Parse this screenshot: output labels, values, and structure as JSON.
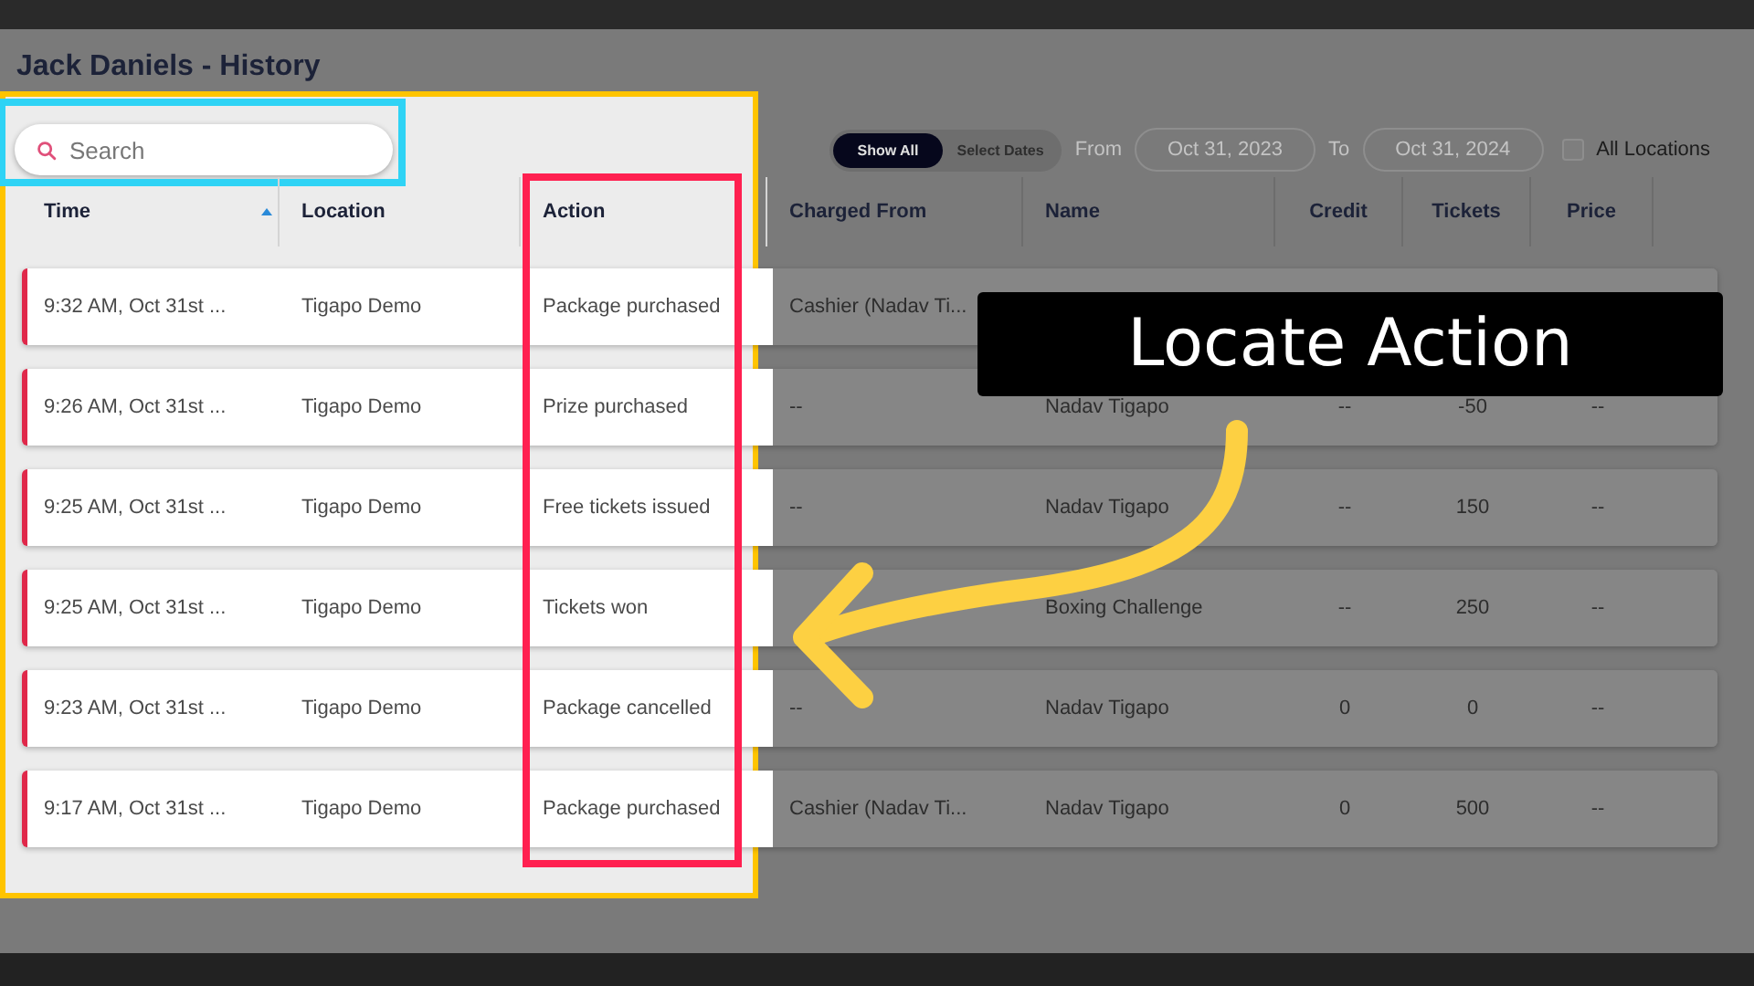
{
  "window": {
    "title": "Jack Daniels - History"
  },
  "search": {
    "placeholder": "Search",
    "outlined": true
  },
  "date_mode": [
    {
      "label": "Show All",
      "selected": true
    },
    {
      "label": "Select Dates",
      "selected": false
    }
  ],
  "date_range": {
    "from_label": "From",
    "from_value": "Oct 31, 2023",
    "to_label": "To",
    "to_value": "Oct 31, 2024"
  },
  "all_locations": {
    "label": "All Locations",
    "checked": false
  },
  "table": {
    "columns": [
      {
        "label": "Time",
        "sorted": true,
        "highlighted": true,
        "outlined": false
      },
      {
        "label": "Location",
        "sorted": false,
        "highlighted": true,
        "outlined": false
      },
      {
        "label": "Action",
        "sorted": false,
        "highlighted": true,
        "outlined": true
      },
      {
        "label": "Charged From",
        "sorted": false,
        "highlighted": false,
        "outlined": false
      },
      {
        "label": "Name",
        "sorted": false,
        "highlighted": false,
        "outlined": false
      },
      {
        "label": "Credit",
        "sorted": false,
        "highlighted": false,
        "outlined": false
      },
      {
        "label": "Tickets",
        "sorted": false,
        "highlighted": false,
        "outlined": false
      },
      {
        "label": "Price",
        "sorted": false,
        "highlighted": false,
        "outlined": false
      }
    ],
    "rows": [
      [
        "9:32 AM, Oct 31st ...",
        "Tigapo Demo",
        "Package purchased",
        "Cashier (Nadav Ti...",
        null,
        null,
        null,
        null
      ],
      [
        "9:26 AM, Oct 31st ...",
        "Tigapo Demo",
        "Prize purchased",
        "--",
        "Nadav Tigapo",
        "--",
        "-50",
        "--"
      ],
      [
        "9:25 AM, Oct 31st ...",
        "Tigapo Demo",
        "Free tickets issued",
        "--",
        "Nadav Tigapo",
        "--",
        "150",
        "--"
      ],
      [
        "9:25 AM, Oct 31st ...",
        "Tigapo Demo",
        "Tickets won",
        null,
        "Boxing Challenge",
        "--",
        "250",
        "--"
      ],
      [
        "9:23 AM, Oct 31st ...",
        "Tigapo Demo",
        "Package cancelled",
        "--",
        "Nadav Tigapo",
        "0",
        "0",
        "--"
      ],
      [
        "9:17 AM, Oct 31st ...",
        "Tigapo Demo",
        "Package purchased",
        "Cashier (Nadav Ti...",
        "Nadav Tigapo",
        "0",
        "500",
        "--"
      ]
    ]
  },
  "annotation": {
    "callout": "Locate Action"
  }
}
